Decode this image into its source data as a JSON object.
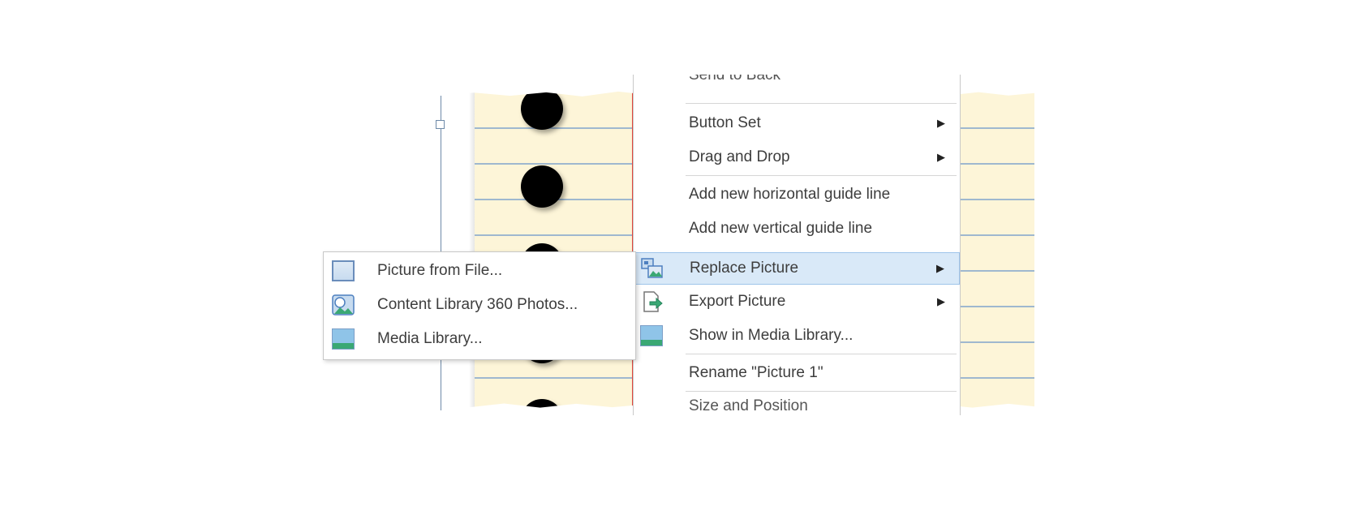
{
  "context_menu": {
    "cut_top_label": "Send to Back",
    "items": [
      {
        "label": "Button Set",
        "has_submenu": true
      },
      {
        "label": "Drag and Drop",
        "has_submenu": true
      },
      {
        "label": "Add new horizontal guide line",
        "has_submenu": false
      },
      {
        "label": "Add new vertical guide line",
        "has_submenu": false
      },
      {
        "label": "Replace Picture",
        "has_submenu": true,
        "highlighted": true,
        "icon": "replace-picture-icon"
      },
      {
        "label": "Export Picture",
        "has_submenu": true,
        "icon": "export-picture-icon"
      },
      {
        "label": "Show in Media Library...",
        "has_submenu": false,
        "icon": "media-library-icon"
      },
      {
        "label": "Rename \"Picture 1\"",
        "has_submenu": false
      }
    ],
    "cut_bottom_label": "Size and Position"
  },
  "submenu": {
    "items": [
      {
        "label": "Picture from File...",
        "icon": "picture-file-icon"
      },
      {
        "label": "Content Library 360 Photos...",
        "icon": "photos-360-icon"
      },
      {
        "label": "Media Library...",
        "icon": "media-library-icon"
      }
    ]
  },
  "glyphs": {
    "submenu_arrow": "▶"
  },
  "colors": {
    "highlight": "#d9e9f8",
    "paper": "#fdf5d8",
    "margin_line": "#e0453d",
    "rule_line": "#9fb8cf"
  }
}
